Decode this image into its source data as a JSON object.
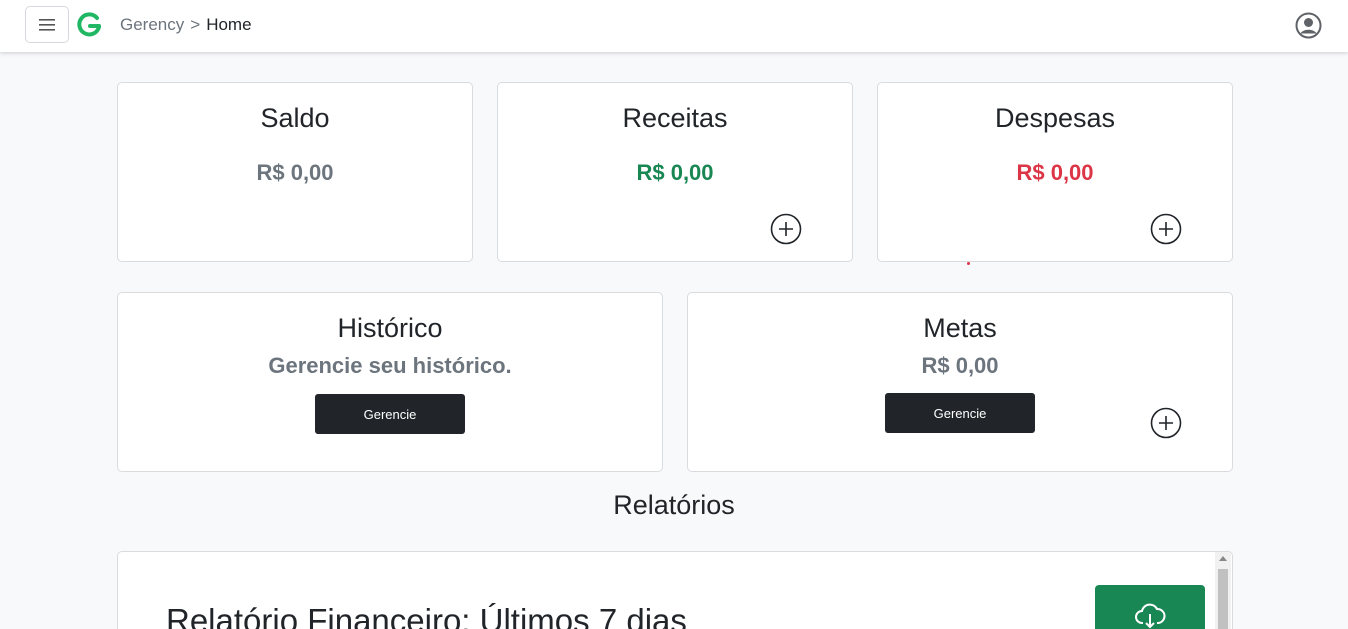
{
  "navbar": {
    "menu_icon": "hamburger-menu-icon",
    "logo_icon": "gerency-logo-icon",
    "breadcrumb": {
      "root": "Gerency",
      "separator": ">",
      "current": "Home"
    },
    "user_icon": "user-circle-icon"
  },
  "cards": {
    "saldo": {
      "title": "Saldo",
      "value": "R$ 0,00",
      "color": "#6c757d"
    },
    "receitas": {
      "title": "Receitas",
      "value": "R$ 0,00",
      "color": "#198754",
      "add_icon": "plus-circle-icon"
    },
    "despesas": {
      "title": "Despesas",
      "value": "R$ 0,00",
      "color": "#dc3545",
      "add_icon": "plus-circle-icon"
    },
    "historico": {
      "title": "Histórico",
      "subtitle": "Gerencie seu histórico.",
      "button": "Gerencie"
    },
    "metas": {
      "title": "Metas",
      "value": "R$ 0,00",
      "button": "Gerencie",
      "add_icon": "plus-circle-icon"
    }
  },
  "reports": {
    "section_title": "Relatórios",
    "panel_title": "Relatório Financeiro: Últimos 7 dias",
    "download_icon": "cloud-download-icon",
    "download_color": "#198754"
  }
}
